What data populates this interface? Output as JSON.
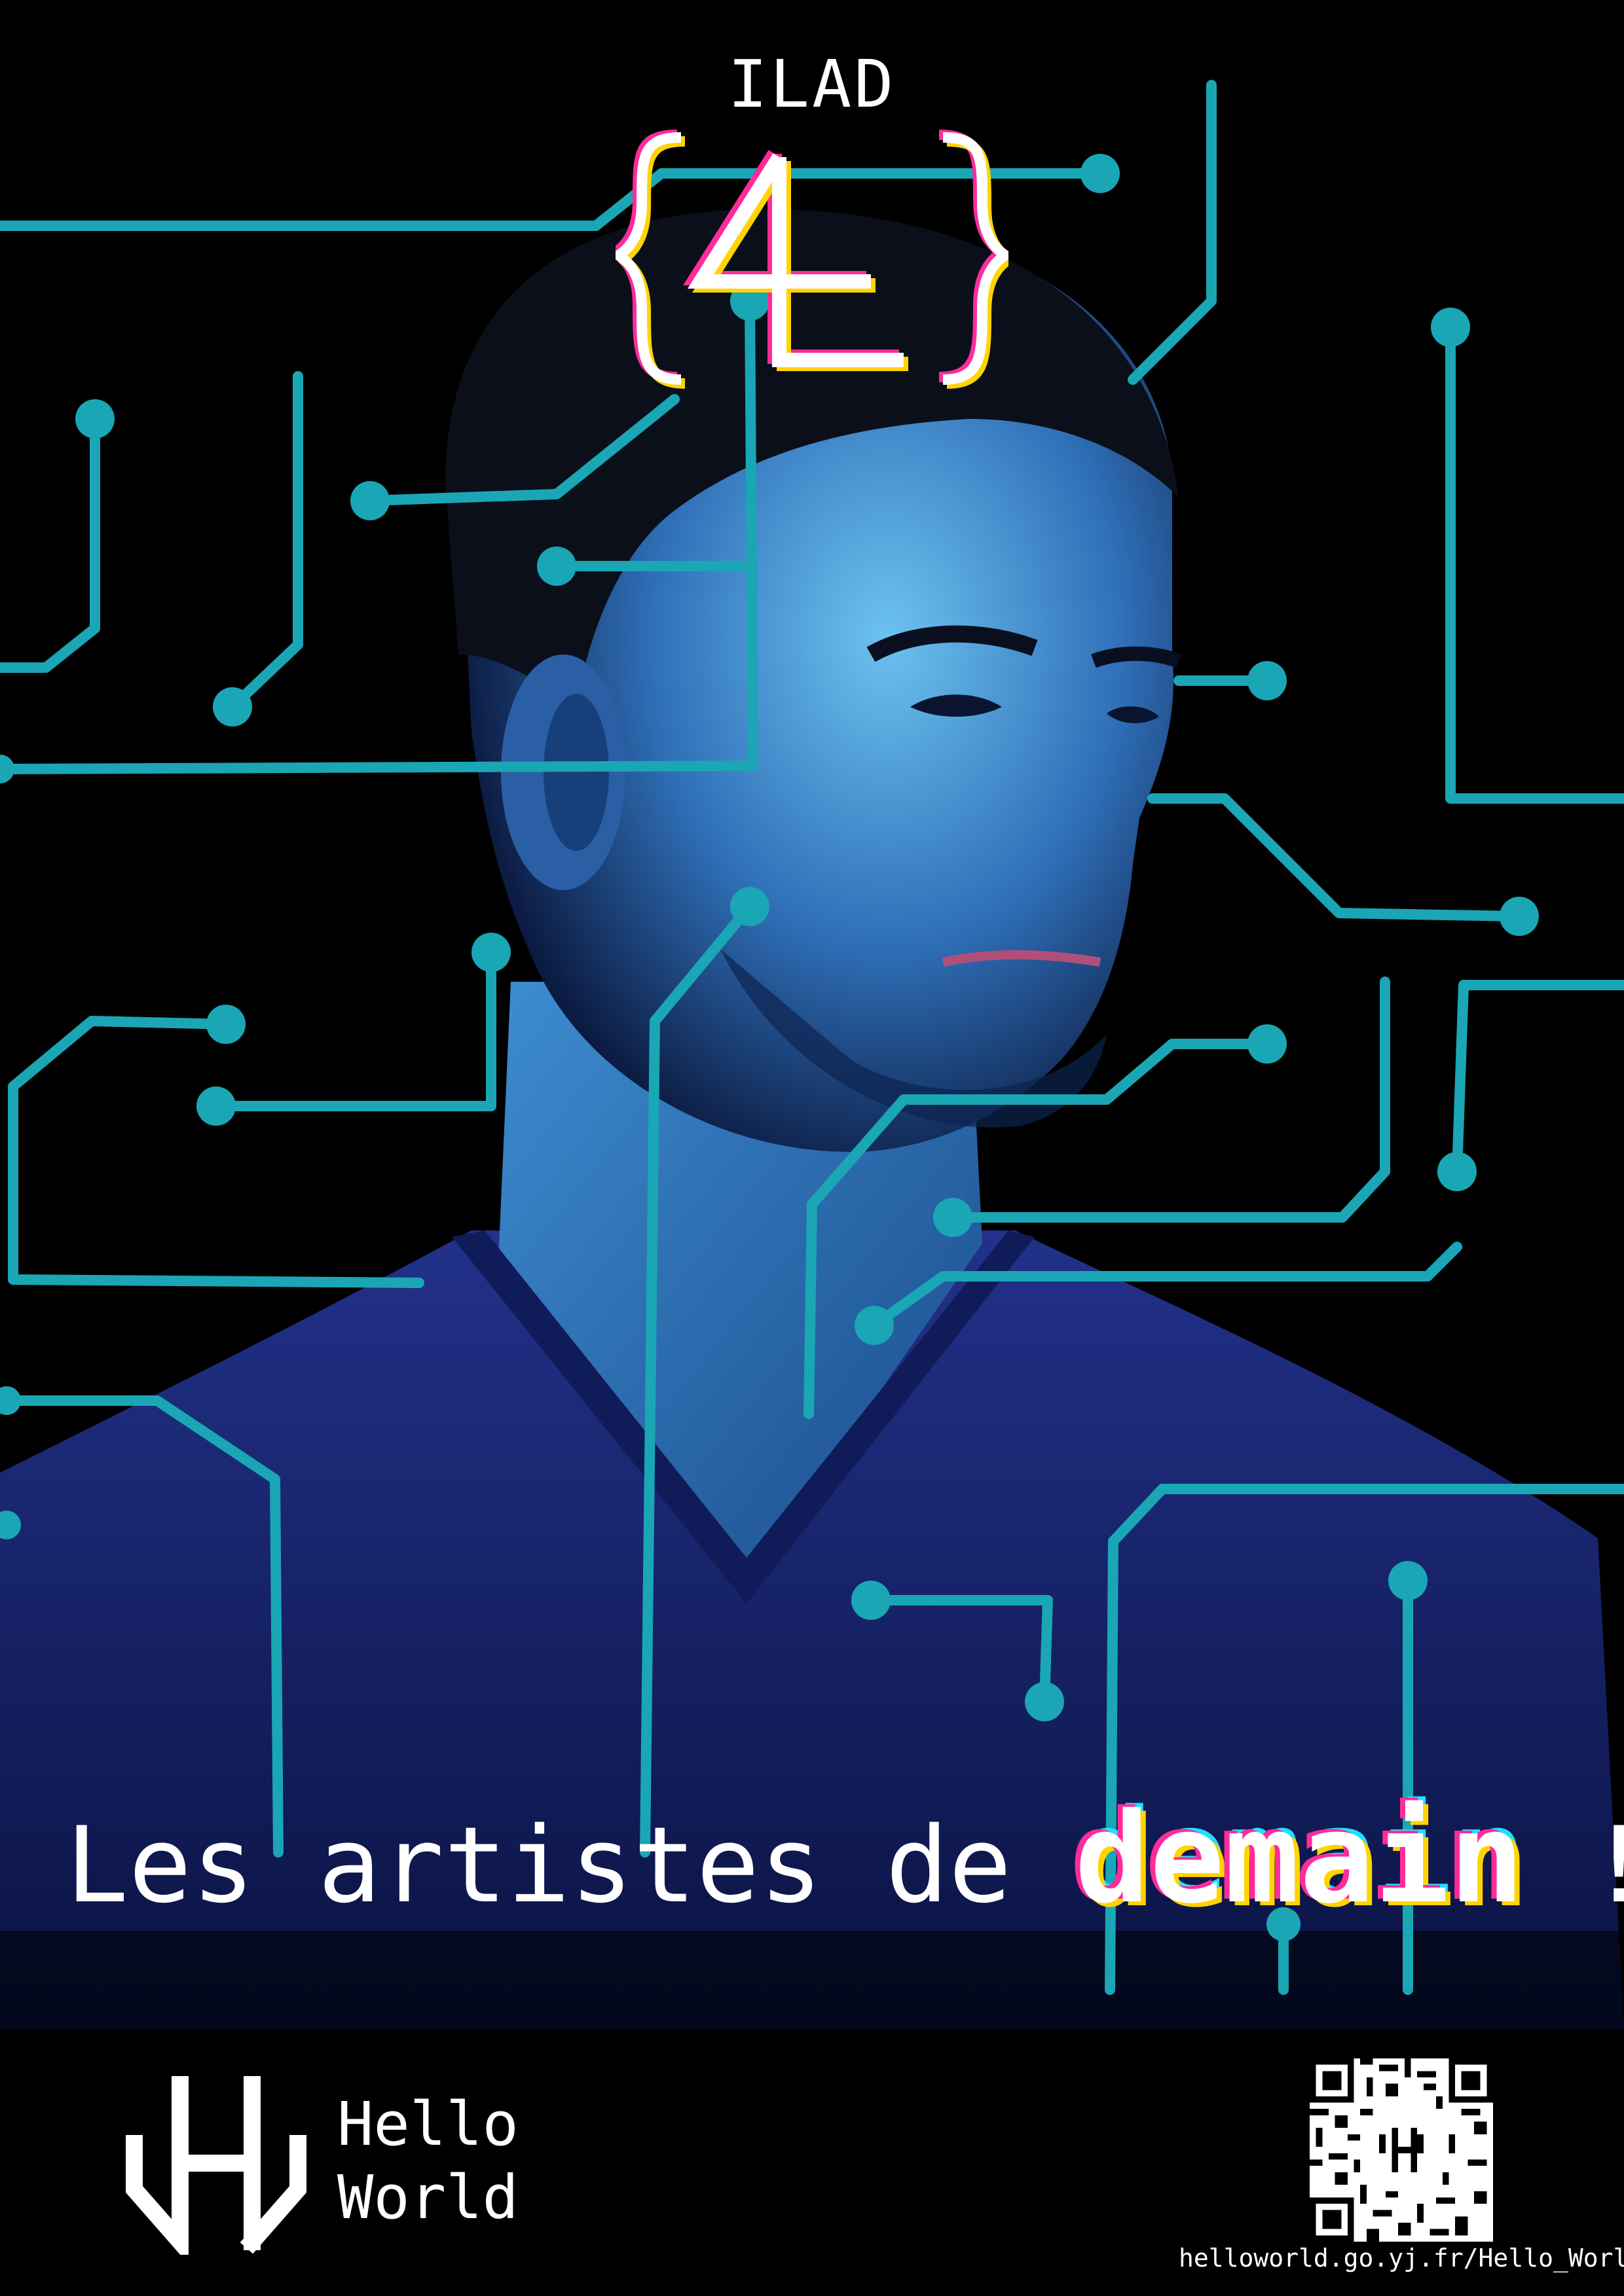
{
  "logo": {
    "top_text": "ILAD",
    "mark_text": "4L",
    "icon": "braces-4l-logo"
  },
  "tagline": {
    "before": "Les artistes de ",
    "highlight": "demain",
    "after": " !"
  },
  "brand": {
    "line1": "Hello",
    "line2": "World",
    "icon": "hello-world-logo"
  },
  "qr": {
    "icon": "qr-code",
    "url": "helloworld.go.yj.fr/Hello_World"
  },
  "colors": {
    "background": "#000000",
    "circuit": "#1aa6b5",
    "skin_light": "#4aa6e0",
    "shirt": "#1c2a7a",
    "accent_pink": "#ff2b9a",
    "accent_yellow": "#ffd400",
    "accent_cyan": "#20e0ff",
    "text": "#ffffff"
  }
}
